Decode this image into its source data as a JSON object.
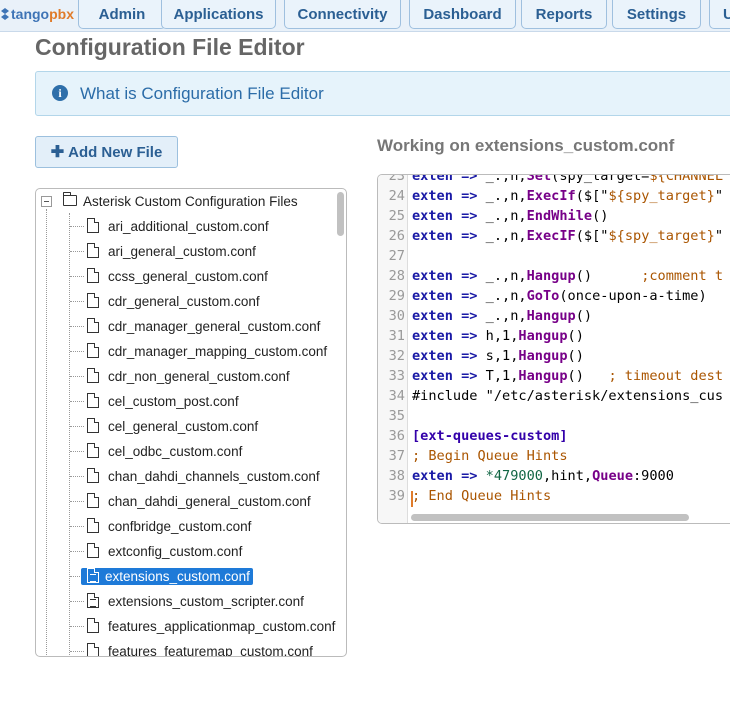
{
  "logo": {
    "text_tango": "tango",
    "text_pbx": "pbx"
  },
  "nav": {
    "tabs": [
      {
        "label": "Admin"
      },
      {
        "label": "Applications"
      },
      {
        "label": "Connectivity"
      },
      {
        "label": "Dashboard"
      },
      {
        "label": "Reports"
      },
      {
        "label": "Settings"
      },
      {
        "label": "U"
      }
    ]
  },
  "page": {
    "title": "Configuration File Editor",
    "info_text": "What is Configuration File Editor",
    "add_button": "Add New File",
    "working_on": "Working on extensions_custom.conf"
  },
  "tree": {
    "root_label": "Asterisk Custom Configuration Files",
    "selected_file": "extensions_custom.conf",
    "files": [
      {
        "name": "ari_additional_custom.conf",
        "icon": "file-icon"
      },
      {
        "name": "ari_general_custom.conf",
        "icon": "file-icon"
      },
      {
        "name": "ccss_general_custom.conf",
        "icon": "file-icon"
      },
      {
        "name": "cdr_general_custom.conf",
        "icon": "file-icon"
      },
      {
        "name": "cdr_manager_general_custom.conf",
        "icon": "file-icon"
      },
      {
        "name": "cdr_manager_mapping_custom.conf",
        "icon": "file-icon"
      },
      {
        "name": "cdr_non_general_custom.conf",
        "icon": "file-icon"
      },
      {
        "name": "cel_custom_post.conf",
        "icon": "file-icon"
      },
      {
        "name": "cel_general_custom.conf",
        "icon": "file-icon"
      },
      {
        "name": "cel_odbc_custom.conf",
        "icon": "file-icon"
      },
      {
        "name": "chan_dahdi_channels_custom.conf",
        "icon": "file-icon"
      },
      {
        "name": "chan_dahdi_general_custom.conf",
        "icon": "file-icon"
      },
      {
        "name": "confbridge_custom.conf",
        "icon": "file-icon"
      },
      {
        "name": "extconfig_custom.conf",
        "icon": "file-icon"
      },
      {
        "name": "extensions_custom.conf",
        "icon": "file-text-icon"
      },
      {
        "name": "extensions_custom_scripter.conf",
        "icon": "file-text-icon"
      },
      {
        "name": "features_applicationmap_custom.conf",
        "icon": "file-icon"
      },
      {
        "name": "features_featuremap_custom.conf",
        "icon": "file-icon"
      }
    ]
  },
  "editor": {
    "line_numbers": [
      "23",
      "24",
      "25",
      "26",
      "27",
      "28",
      "29",
      "30",
      "31",
      "32",
      "33",
      "34",
      "35",
      "36",
      "37",
      "38",
      "39"
    ],
    "lines": [
      "exten => _.,n,Set(spy_target=${CHANNEL",
      "exten => _.,n,ExecIf($[\"${spy_target}\"",
      "exten => _.,n,EndWhile()",
      "exten => _.,n,ExecIF($[\"${spy_target}\"",
      "",
      "exten => _.,n,Hangup()      ;comment t",
      "exten => _.,n,GoTo(once-upon-a-time)",
      "exten => _.,n,Hangup()",
      "exten => h,1,Hangup()",
      "exten => s,1,Hangup()",
      "exten => T,1,Hangup()   ; timeout dest",
      "#include \"/etc/asterisk/extensions_cus",
      "",
      "[ext-queues-custom]",
      "; Begin Queue Hints",
      "exten => *479000,hint,Queue:9000",
      "; End Queue Hints"
    ]
  },
  "colors": {
    "accent": "#2b5f93",
    "selected_bg": "#1e7ad8",
    "info_bg": "#e6f3fb",
    "logo_pbx": "#e07b2a"
  }
}
